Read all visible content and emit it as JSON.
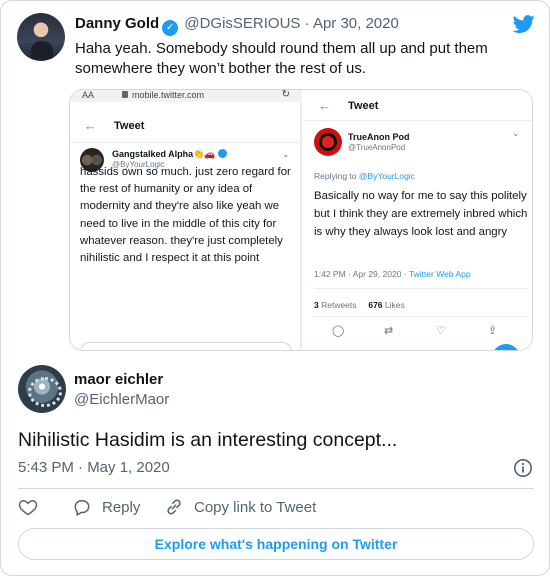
{
  "quoted_tweet": {
    "author_name": "Danny Gold",
    "author_handle": "@DGisSERIOUS",
    "separator": "·",
    "date": "Apr 30, 2020",
    "text": "Haha yeah. Somebody should round them all up and put them somewhere they won’t bother the rest of us."
  },
  "embedded_left": {
    "browser_aa": "AA",
    "browser_url": "mobile.twitter.com",
    "nav_title": "Tweet",
    "author_name": "Gangstalked Alpha",
    "author_emoji": "👏🚗",
    "author_handle": "@ByYourLogic",
    "text": "hassids own so much. just zero regard for the rest of humanity or any idea of modernity and they're also like yeah we need to live in the middle of this city for whatever reason. they're just completely nihilistic and I respect it at this point"
  },
  "embedded_right": {
    "nav_title": "Tweet",
    "author_name": "TrueAnon Pod",
    "author_handle": "@TrueAnonPod",
    "replying_prefix": "Replying to ",
    "replying_to": "@ByYourLogic",
    "text": "Basically no way for me to say this politely but I think they are extremely inbred which is why they always look lost and angry",
    "meta_time": "1:42 PM · Apr 29, 2020 · ",
    "meta_source": "Twitter Web App",
    "retweets_count": "3",
    "retweets_label": " Retweets",
    "likes_count": "676",
    "likes_label": " Likes"
  },
  "main_tweet": {
    "author_name": "maor eichler",
    "author_handle": "@EichlerMaor",
    "text": "Nihilistic Hasidim is an interesting concept...",
    "timestamp": "5:43 PM · May 1, 2020",
    "reply_label": "Reply",
    "copy_label": "Copy link to Tweet",
    "explore_label": "Explore what's happening on Twitter"
  },
  "colors": {
    "accent": "#1d9bf0",
    "text": "#0f1419",
    "secondary": "#536471",
    "border": "#cfd9de"
  }
}
